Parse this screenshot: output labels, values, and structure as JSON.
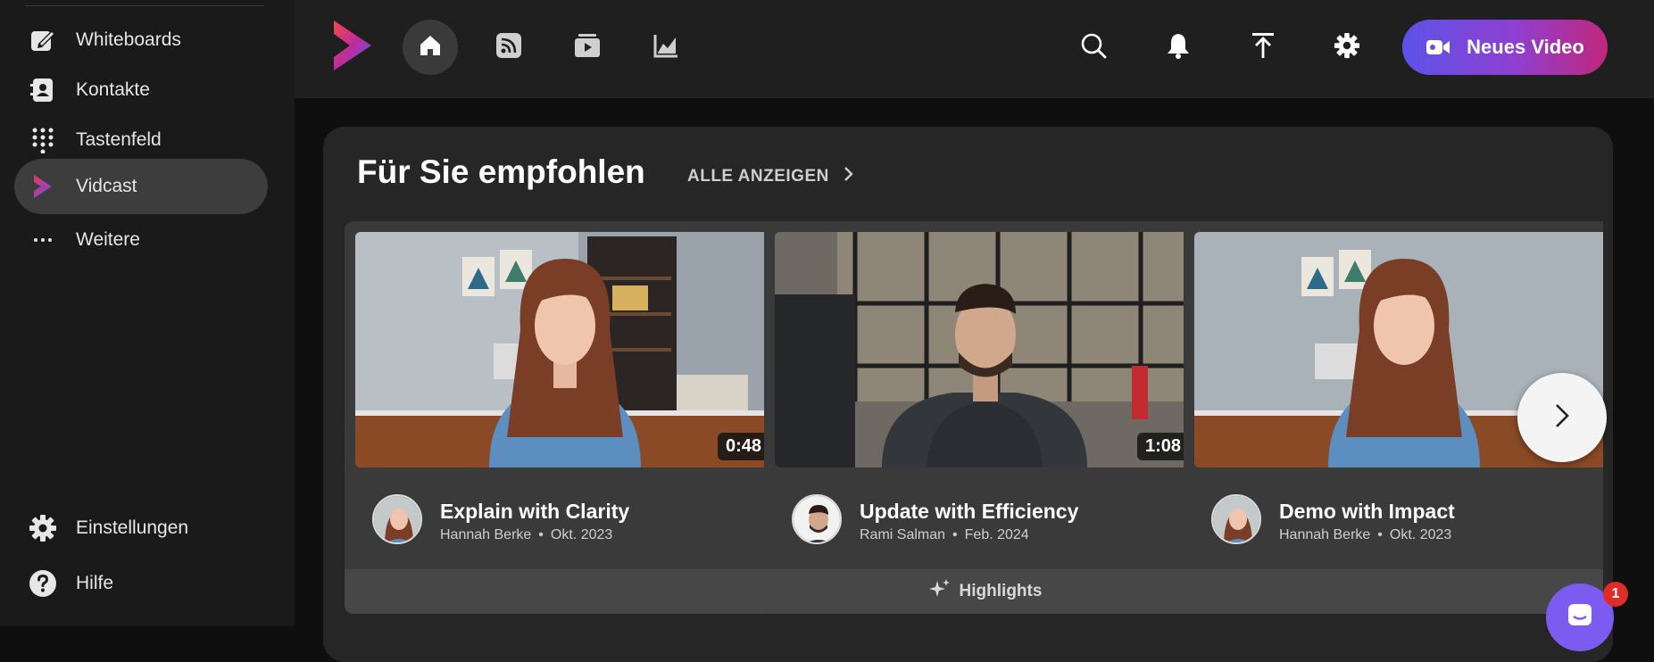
{
  "sidebar": {
    "items": [
      {
        "label": "Whiteboards",
        "icon": "whiteboard-icon"
      },
      {
        "label": "Kontakte",
        "icon": "contacts-icon"
      },
      {
        "label": "Tastenfeld",
        "icon": "keypad-icon"
      },
      {
        "label": "Vidcast",
        "icon": "vidcast-icon",
        "active": true
      },
      {
        "label": "Weitere",
        "icon": "more-dots-icon"
      }
    ],
    "bottom_items": [
      {
        "label": "Einstellungen",
        "icon": "gear-icon"
      },
      {
        "label": "Hilfe",
        "icon": "help-icon"
      }
    ]
  },
  "topbar": {
    "nav_icons": [
      "home-icon",
      "feed-icon",
      "library-icon",
      "analytics-icon"
    ],
    "action_icons": [
      "search-icon",
      "bell-icon",
      "upload-icon",
      "gear-icon"
    ],
    "new_video_label": "Neues Video"
  },
  "main": {
    "section_title": "Für Sie empfohlen",
    "show_all_label": "ALLE ANZEIGEN",
    "cards": [
      {
        "title": "Explain with Clarity",
        "author": "Hannah Berke",
        "date": "Okt. 2023",
        "duration": "0:48",
        "footer": ""
      },
      {
        "title": "Update with Efficiency",
        "author": "Rami Salman",
        "date": "Feb. 2024",
        "duration": "1:08",
        "footer": "Highlights"
      },
      {
        "title": "Demo with Impact",
        "author": "Hannah Berke",
        "date": "Okt. 2023",
        "duration": "",
        "footer": ""
      }
    ]
  },
  "chat": {
    "badge_count": "1"
  },
  "colors": {
    "accent_gradient_start": "#5d52e8",
    "accent_gradient_end": "#c0277a",
    "badge": "#e02b2b"
  }
}
